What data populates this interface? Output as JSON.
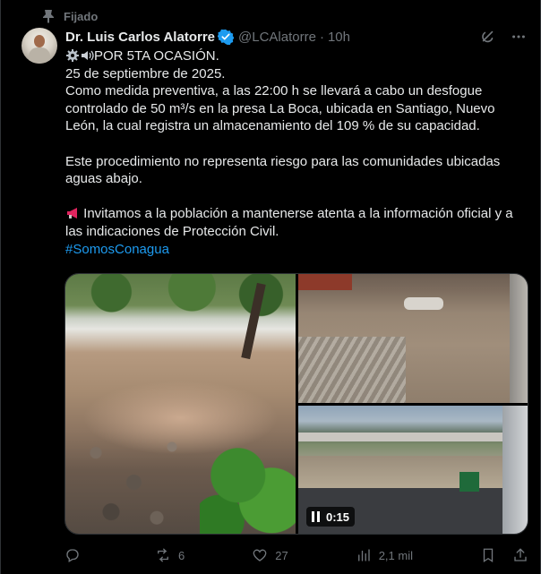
{
  "pinned_label": "Fijado",
  "author": {
    "display_name": "Dr. Luis Carlos Alatorre",
    "handle": "@LCAlatorre",
    "separator": "·",
    "time": "10h",
    "verified": true
  },
  "tweet": {
    "line1": "POR 5TA OCASIÓN.",
    "line2": "25 de septiembre de 2025.",
    "paragraph1": "Como medida preventiva, a las 22:00 h se llevará a cabo un desfogue controlado de 50 m³/s en la presa La Boca, ubicada en Santiago, Nuevo León, la cual registra un almacenamiento del 109 % de su capacidad.",
    "paragraph2": "Este procedimiento no representa riesgo para las comunidades ubicadas aguas abajo.",
    "paragraph3": "Invitamos a la población a mantenerse atenta a la información oficial y a las indicaciones de Protección Civil.",
    "hashtag": "#SomosConagua"
  },
  "media": {
    "video_time": "0:15"
  },
  "actions": {
    "replies": "",
    "reposts": "6",
    "likes": "27",
    "views": "2,1 mil"
  },
  "colors": {
    "background": "#000000",
    "text": "#e7e9ea",
    "muted": "#71767b",
    "link": "#1d9bf0",
    "border": "#2f3336"
  }
}
